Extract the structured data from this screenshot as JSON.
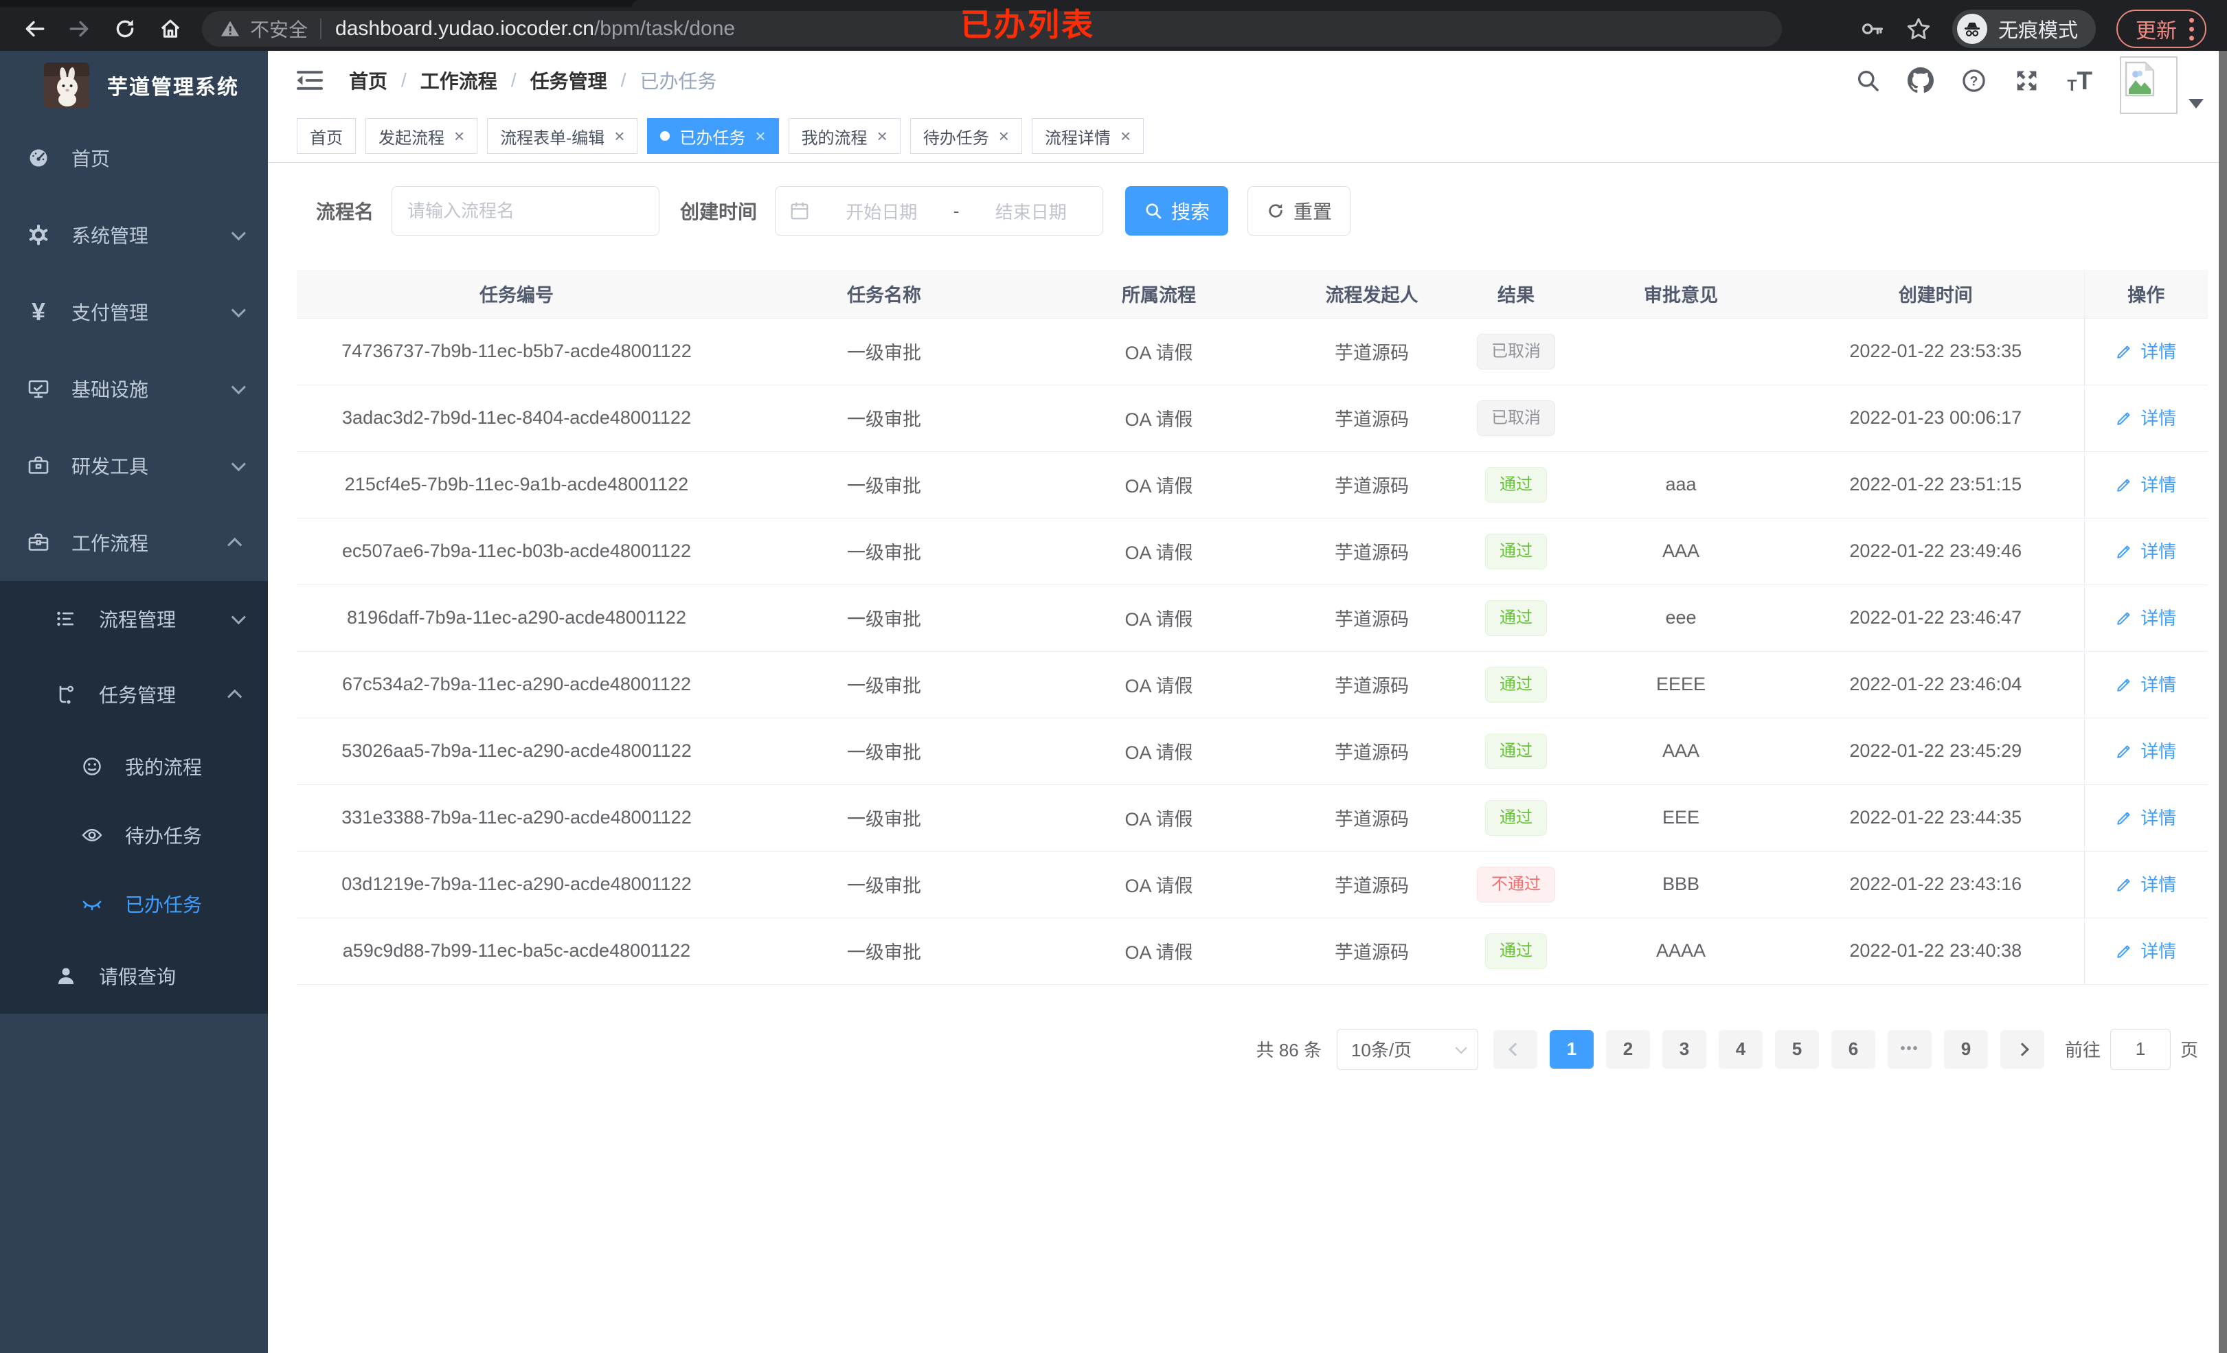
{
  "browser": {
    "security_text": "不安全",
    "url_host": "dashboard.yudao.iocoder.cn",
    "url_path": "/bpm/task/done",
    "incognito_label": "无痕模式",
    "update_label": "更新",
    "icons": [
      "back-arrow",
      "forward-arrow",
      "reload",
      "home",
      "warning-triangle",
      "key",
      "star",
      "incognito-hat-glasses",
      "kebab-menu"
    ]
  },
  "annotation": {
    "text": "已办列表",
    "color": "#ff2d05"
  },
  "sidebar": {
    "brand": "芋道管理系统",
    "menu": [
      {
        "label": "首页",
        "level": 1,
        "icon": "dashboard-icon"
      },
      {
        "label": "系统管理",
        "level": 1,
        "icon": "gear-icon",
        "chevron": "down"
      },
      {
        "label": "支付管理",
        "level": 1,
        "icon": "yen-icon",
        "chevron": "down"
      },
      {
        "label": "基础设施",
        "level": 1,
        "icon": "monitor-icon",
        "chevron": "down"
      },
      {
        "label": "研发工具",
        "level": 1,
        "icon": "toolbox-icon",
        "chevron": "down"
      },
      {
        "label": "工作流程",
        "level": 1,
        "icon": "briefcase-icon",
        "chevron": "up"
      },
      {
        "label": "流程管理",
        "level": 2,
        "icon": "tree-icon",
        "chevron": "down"
      },
      {
        "label": "任务管理",
        "level": 2,
        "icon": "flow-icon",
        "chevron": "up"
      },
      {
        "label": "我的流程",
        "level": 3,
        "icon": "face-icon"
      },
      {
        "label": "待办任务",
        "level": 3,
        "icon": "eye-icon"
      },
      {
        "label": "已办任务",
        "level": 3,
        "icon": "eye-closed-icon",
        "active": true
      },
      {
        "label": "请假查询",
        "level": 2,
        "icon": "person-icon"
      }
    ]
  },
  "header": {
    "breadcrumb": [
      "首页",
      "工作流程",
      "任务管理",
      "已办任务"
    ],
    "icons": [
      "search-icon",
      "github-icon",
      "help-icon",
      "fullscreen-icon",
      "font-size-icon",
      "avatar-broken-image",
      "caret-down-icon"
    ]
  },
  "tabs": [
    {
      "label": "首页",
      "closable": false,
      "active": false
    },
    {
      "label": "发起流程",
      "closable": true,
      "active": false
    },
    {
      "label": "流程表单-编辑",
      "closable": true,
      "active": false
    },
    {
      "label": "已办任务",
      "closable": true,
      "active": true
    },
    {
      "label": "我的流程",
      "closable": true,
      "active": false
    },
    {
      "label": "待办任务",
      "closable": true,
      "active": false
    },
    {
      "label": "流程详情",
      "closable": true,
      "active": false
    }
  ],
  "filter": {
    "name_label": "流程名",
    "name_placeholder": "请输入流程名",
    "time_label": "创建时间",
    "start_placeholder": "开始日期",
    "range_separator": "-",
    "end_placeholder": "结束日期",
    "search_label": "搜索",
    "reset_label": "重置"
  },
  "table": {
    "columns": [
      "任务编号",
      "任务名称",
      "所属流程",
      "流程发起人",
      "结果",
      "审批意见",
      "创建时间",
      "操作"
    ],
    "action_label": "详情",
    "rows": [
      {
        "id": "74736737-7b9b-11ec-b5b7-acde48001122",
        "name": "一级审批",
        "process": "OA 请假",
        "starter": "芋道源码",
        "result": "已取消",
        "result_type": "info",
        "comment": "",
        "time": "2022-01-22 23:53:35"
      },
      {
        "id": "3adac3d2-7b9d-11ec-8404-acde48001122",
        "name": "一级审批",
        "process": "OA 请假",
        "starter": "芋道源码",
        "result": "已取消",
        "result_type": "info",
        "comment": "",
        "time": "2022-01-23 00:06:17"
      },
      {
        "id": "215cf4e5-7b9b-11ec-9a1b-acde48001122",
        "name": "一级审批",
        "process": "OA 请假",
        "starter": "芋道源码",
        "result": "通过",
        "result_type": "success",
        "comment": "aaa",
        "time": "2022-01-22 23:51:15"
      },
      {
        "id": "ec507ae6-7b9a-11ec-b03b-acde48001122",
        "name": "一级审批",
        "process": "OA 请假",
        "starter": "芋道源码",
        "result": "通过",
        "result_type": "success",
        "comment": "AAA",
        "time": "2022-01-22 23:49:46"
      },
      {
        "id": "8196daff-7b9a-11ec-a290-acde48001122",
        "name": "一级审批",
        "process": "OA 请假",
        "starter": "芋道源码",
        "result": "通过",
        "result_type": "success",
        "comment": "eee",
        "time": "2022-01-22 23:46:47"
      },
      {
        "id": "67c534a2-7b9a-11ec-a290-acde48001122",
        "name": "一级审批",
        "process": "OA 请假",
        "starter": "芋道源码",
        "result": "通过",
        "result_type": "success",
        "comment": "EEEE",
        "time": "2022-01-22 23:46:04"
      },
      {
        "id": "53026aa5-7b9a-11ec-a290-acde48001122",
        "name": "一级审批",
        "process": "OA 请假",
        "starter": "芋道源码",
        "result": "通过",
        "result_type": "success",
        "comment": "AAA",
        "time": "2022-01-22 23:45:29"
      },
      {
        "id": "331e3388-7b9a-11ec-a290-acde48001122",
        "name": "一级审批",
        "process": "OA 请假",
        "starter": "芋道源码",
        "result": "通过",
        "result_type": "success",
        "comment": "EEE",
        "time": "2022-01-22 23:44:35"
      },
      {
        "id": "03d1219e-7b9a-11ec-a290-acde48001122",
        "name": "一级审批",
        "process": "OA 请假",
        "starter": "芋道源码",
        "result": "不通过",
        "result_type": "danger",
        "comment": "BBB",
        "time": "2022-01-22 23:43:16"
      },
      {
        "id": "a59c9d88-7b99-11ec-ba5c-acde48001122",
        "name": "一级审批",
        "process": "OA 请假",
        "starter": "芋道源码",
        "result": "通过",
        "result_type": "success",
        "comment": "AAAA",
        "time": "2022-01-22 23:40:38"
      }
    ]
  },
  "pagination": {
    "total": "共 86 条",
    "page_size": "10条/页",
    "pages": [
      "1",
      "2",
      "3",
      "4",
      "5",
      "6",
      "•••",
      "9"
    ],
    "current_page": "1",
    "goto_label": "前往",
    "goto_value": "1",
    "goto_suffix": "页"
  },
  "colors": {
    "accent": "#409eff",
    "sidebar_bg": "#304156",
    "submenu_bg": "#1f2d3d",
    "success": "#67c23a",
    "danger": "#f56c6c",
    "info": "#909399",
    "annotation_red": "#ff2d05"
  }
}
